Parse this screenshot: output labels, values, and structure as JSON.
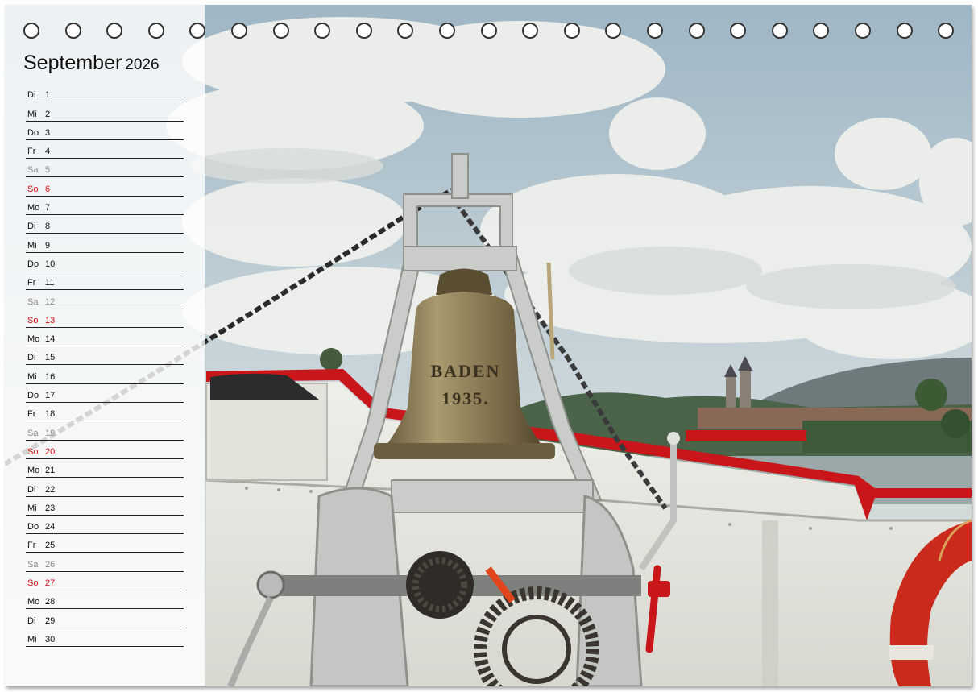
{
  "calendar": {
    "month": "September",
    "year": "2026",
    "rings_count": 23,
    "days": [
      {
        "weekday": "Di",
        "day": "1",
        "type": "weekday"
      },
      {
        "weekday": "Mi",
        "day": "2",
        "type": "weekday"
      },
      {
        "weekday": "Do",
        "day": "3",
        "type": "weekday"
      },
      {
        "weekday": "Fr",
        "day": "4",
        "type": "weekday"
      },
      {
        "weekday": "Sa",
        "day": "5",
        "type": "saturday"
      },
      {
        "weekday": "So",
        "day": "6",
        "type": "sunday"
      },
      {
        "weekday": "Mo",
        "day": "7",
        "type": "weekday"
      },
      {
        "weekday": "Di",
        "day": "8",
        "type": "weekday"
      },
      {
        "weekday": "Mi",
        "day": "9",
        "type": "weekday"
      },
      {
        "weekday": "Do",
        "day": "10",
        "type": "weekday"
      },
      {
        "weekday": "Fr",
        "day": "11",
        "type": "weekday"
      },
      {
        "weekday": "Sa",
        "day": "12",
        "type": "saturday"
      },
      {
        "weekday": "So",
        "day": "13",
        "type": "sunday"
      },
      {
        "weekday": "Mo",
        "day": "14",
        "type": "weekday"
      },
      {
        "weekday": "Di",
        "day": "15",
        "type": "weekday"
      },
      {
        "weekday": "Mi",
        "day": "16",
        "type": "weekday"
      },
      {
        "weekday": "Do",
        "day": "17",
        "type": "weekday"
      },
      {
        "weekday": "Fr",
        "day": "18",
        "type": "weekday"
      },
      {
        "weekday": "Sa",
        "day": "19",
        "type": "saturday"
      },
      {
        "weekday": "So",
        "day": "20",
        "type": "sunday"
      },
      {
        "weekday": "Mo",
        "day": "21",
        "type": "weekday"
      },
      {
        "weekday": "Di",
        "day": "22",
        "type": "weekday"
      },
      {
        "weekday": "Mi",
        "day": "23",
        "type": "weekday"
      },
      {
        "weekday": "Do",
        "day": "24",
        "type": "weekday"
      },
      {
        "weekday": "Fr",
        "day": "25",
        "type": "weekday"
      },
      {
        "weekday": "Sa",
        "day": "26",
        "type": "saturday"
      },
      {
        "weekday": "So",
        "day": "27",
        "type": "sunday"
      },
      {
        "weekday": "Mo",
        "day": "28",
        "type": "weekday"
      },
      {
        "weekday": "Di",
        "day": "29",
        "type": "weekday"
      },
      {
        "weekday": "Mi",
        "day": "30",
        "type": "weekday"
      }
    ]
  },
  "photo": {
    "bell_text_line1": "BADEN",
    "bell_text_line2": "1935.",
    "colors": {
      "sky": "#b8cbd6",
      "cloud": "#eef0ec",
      "railing_red": "#c8161a",
      "hull_white": "#e9e9e3",
      "bell_bronze": "#8d7c55",
      "sunday": "#d21010",
      "saturday": "#8c8c8c"
    }
  }
}
